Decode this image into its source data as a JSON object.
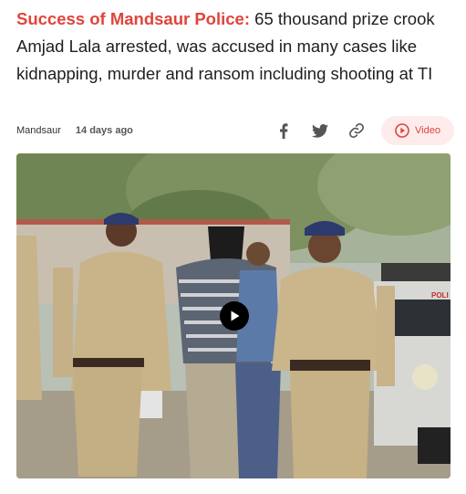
{
  "article": {
    "kicker": "Success of Mandsaur Police:",
    "headline": " 65 thousand prize crook Amjad Lala arrested, was accused in many cases like kidnapping, murder and ransom including shooting at TI"
  },
  "meta": {
    "location": "Mandsaur",
    "time_ago": "14 days ago"
  },
  "share": {
    "icons": [
      "facebook-icon",
      "twitter-icon",
      "link-icon"
    ],
    "video_label": "Video"
  },
  "media": {
    "vehicle_label": "POLI"
  },
  "colors": {
    "accent": "#e0443a",
    "pill_bg": "#fdeceb",
    "icon_gray": "#555555"
  }
}
